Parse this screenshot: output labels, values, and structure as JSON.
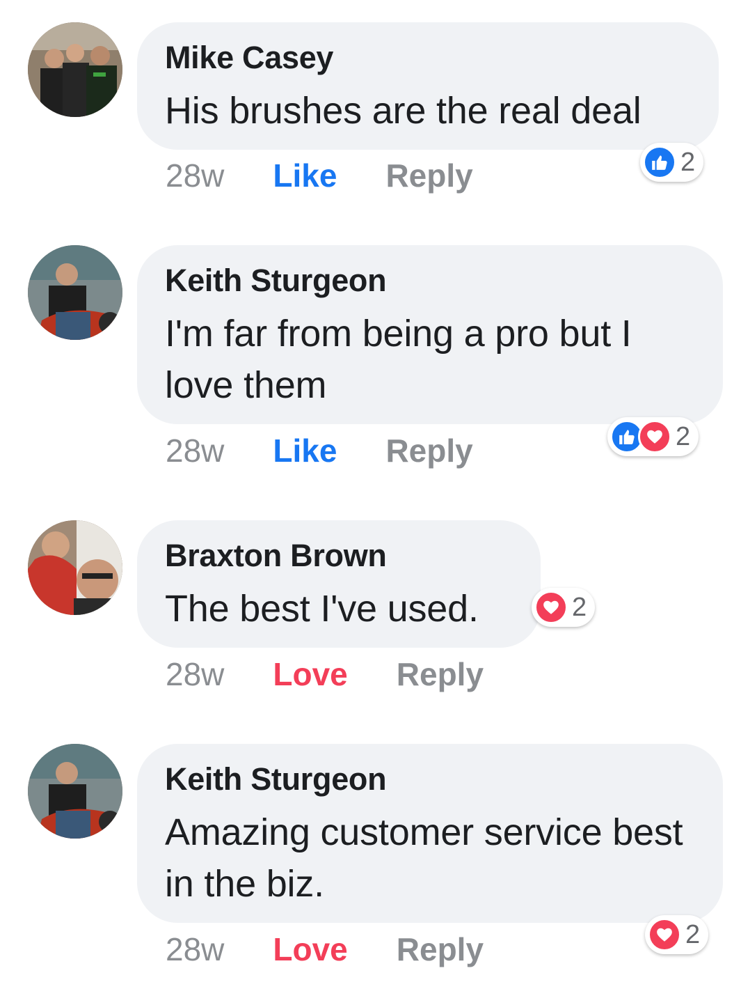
{
  "comments": [
    {
      "author": "Mike Casey",
      "text": "His brushes are the real deal",
      "time": "28w",
      "reaction_action": "Like",
      "reply_label": "Reply",
      "reactions": [
        "like"
      ],
      "reaction_count": "2"
    },
    {
      "author": "Keith Sturgeon",
      "text": "I'm far from being a pro but I love them",
      "time": "28w",
      "reaction_action": "Like",
      "reply_label": "Reply",
      "reactions": [
        "like",
        "love"
      ],
      "reaction_count": "2"
    },
    {
      "author": "Braxton Brown",
      "text": "The best I've used.",
      "time": "28w",
      "reaction_action": "Love",
      "reply_label": "Reply",
      "reactions": [
        "love"
      ],
      "reaction_count": "2"
    },
    {
      "author": "Keith Sturgeon",
      "text": "Amazing customer service best in the biz.",
      "time": "28w",
      "reaction_action": "Love",
      "reply_label": "Reply",
      "reactions": [
        "love"
      ],
      "reaction_count": "2"
    }
  ],
  "colors": {
    "like": "#1877f2",
    "love": "#f33e58",
    "bubble": "#f0f2f5",
    "muted": "#8a8d91"
  },
  "icons": {
    "like": "thumbs-up-icon",
    "love": "heart-icon"
  }
}
